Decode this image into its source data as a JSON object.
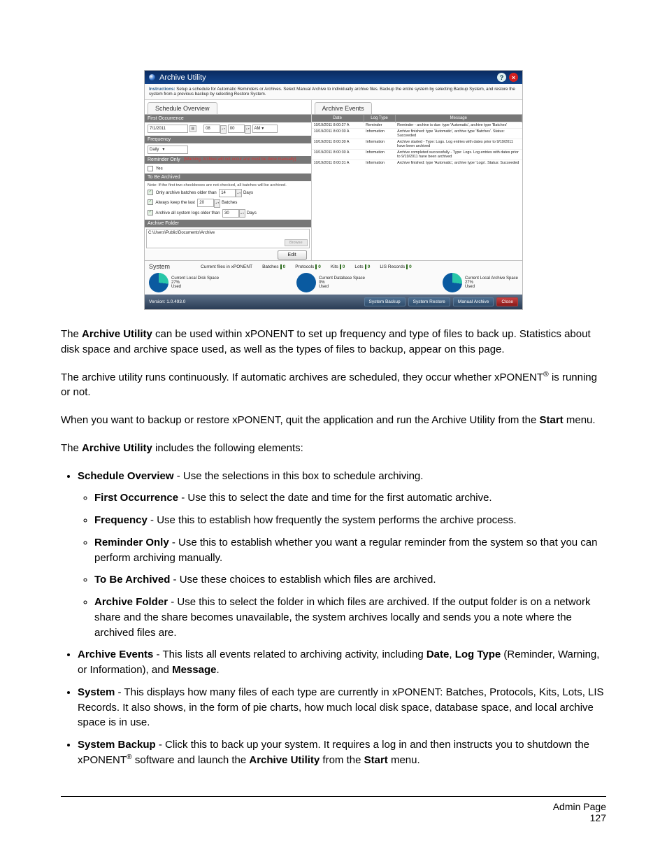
{
  "screenshot": {
    "title": "Archive Utility",
    "instructions_label": "Instructions:",
    "instructions_text": "Setup a schedule for Automatic Reminders or Archives. Select Manual Archive to individually archive files. Backup the entire system by selecting Backup System, and restore the system from a previous backup by selecting Restore System.",
    "tabs": {
      "schedule_overview": "Schedule Overview",
      "archive_events": "Archive Events"
    },
    "schedule": {
      "first_occurrence": {
        "label": "First Occurrence",
        "date": "7/1/2011",
        "hour": "08",
        "minute": "00",
        "ampm": "AM"
      },
      "frequency": {
        "label": "Frequency",
        "value": "Daily"
      },
      "reminder_only": {
        "label": "Reminder Only",
        "warning": "(Warning: Archive will not occur and must be done manually)",
        "checkbox_label": "Yes",
        "checked": false
      },
      "to_be_archived": {
        "label": "To Be Archived",
        "note": "Note: If the first two checkboxes are not checked, all batches will be archived.",
        "only_batches": {
          "label": "Only archive batches older than",
          "value": "14",
          "unit": "Days",
          "checked": true
        },
        "keep_last": {
          "label": "Always keep the last",
          "value": "20",
          "unit": "Batches",
          "checked": true
        },
        "system_logs": {
          "label": "Archive all system logs older than",
          "value": "30",
          "unit": "Days",
          "checked": true
        }
      },
      "archive_folder": {
        "label": "Archive Folder",
        "path": "C:\\Users\\Public\\Documents\\Archive",
        "browse": "Browse"
      },
      "edit_button": "Edit"
    },
    "events": {
      "columns": {
        "date": "Date",
        "log_type": "Log Type",
        "message": "Message"
      },
      "rows": [
        {
          "date": "10/19/2011 8:00:27 A",
          "type": "Reminder",
          "msg": "Reminder - archive is due: type 'Automatic', archive type 'Batches'"
        },
        {
          "date": "10/19/2011 8:00:30 A",
          "type": "Information",
          "msg": "Archive finished: type 'Automatic', archive type 'Batches'. Status: Succeeded"
        },
        {
          "date": "10/19/2011 8:00:30 A",
          "type": "Information",
          "msg": "Archive started - Type: Logs. Log entries with dates prior to 9/19/2011 have been archived"
        },
        {
          "date": "10/19/2011 8:00:30 A",
          "type": "Information",
          "msg": "Archive completed successfully - Type: Logs. Log entries with dates prior to 9/19/2011 have been archived"
        },
        {
          "date": "10/19/2011 8:00:31 A",
          "type": "Information",
          "msg": "Archive finished: type 'Automatic', archive type 'Logs'. Status: Succeeded"
        }
      ]
    },
    "system": {
      "label": "System",
      "files_label": "Current files in xPONENT",
      "batches": {
        "label": "Batches",
        "value": "0"
      },
      "protocols": {
        "label": "Protocols",
        "value": "0"
      },
      "kits": {
        "label": "Kits",
        "value": "0"
      },
      "lots": {
        "label": "Lots",
        "value": "0"
      },
      "lis": {
        "label": "LIS Records",
        "value": "0"
      },
      "disk": {
        "label": "Current Local Disk Space",
        "percent": "27%",
        "used": "Used"
      },
      "db": {
        "label": "Current Database Space",
        "percent": "0%",
        "used": "Used"
      },
      "arch": {
        "label": "Current Local Archive Space",
        "percent": "27%",
        "used": "Used"
      }
    },
    "footer": {
      "version": "Version: 1.0.493.0",
      "buttons": {
        "backup": "System Backup",
        "restore": "System Restore",
        "manual": "Manual Archive",
        "close": "Close"
      }
    }
  },
  "body": {
    "p1_a": "The ",
    "p1_b": "Archive Utility",
    "p1_c": " can be used within xPONENT to set up frequency and type of files to back up. Statistics about disk space and archive space used, as well as the types of files to backup, appear on this page.",
    "p2_a": "The archive utility runs continuously. If automatic archives are scheduled, they occur whether xPONENT",
    "p2_b": " is running or not.",
    "p3": "When you want to backup or restore xPONENT, quit the application and run the Archive Utility from the ",
    "p3_b": "Start",
    "p3_c": " menu.",
    "p4_a": "The ",
    "p4_b": "Archive Utility",
    "p4_c": " includes the following elements:",
    "b1": {
      "t": "Schedule Overview",
      "d": " - Use the selections in this box to schedule archiving."
    },
    "b1a": {
      "t": "First Occurrence",
      "d": " - Use this to select the date and time for the first automatic archive."
    },
    "b1b": {
      "t": "Frequency",
      "d": " - Use this to establish how frequently the system performs the archive process."
    },
    "b1c": {
      "t": "Reminder Only",
      "d": " - Use this to establish whether you want a regular reminder from the system so that you can perform archiving manually."
    },
    "b1d": {
      "t": "To Be Archived",
      "d": " - Use these choices to establish which files are archived."
    },
    "b1e": {
      "t": "Archive Folder",
      "d": " - Use this to select the folder in which files are archived. If the output folder is on a network share and the share becomes unavailable, the system archives locally and sends you a note where the archived files are."
    },
    "b2_a": "Archive Events",
    "b2_b": " - This lists all events related to archiving activity, including ",
    "b2_c": "Date",
    "b2_d": ", ",
    "b2_e": "Log Type",
    "b2_f": " (Reminder, Warning, or Information), and ",
    "b2_g": "Message",
    "b2_h": ".",
    "b3": {
      "t": "System",
      "d": " - This displays how many files of each type are currently in xPONENT: Batches, Protocols, Kits, Lots, LIS Records. It also shows, in the form of pie charts, how much local disk space, database space, and local archive space is in use."
    },
    "b4_a": "System Backup",
    "b4_b": " - Click this to back up your system. It requires a log in and then instructs you to shutdown the xPONENT",
    "b4_c": " software and launch the ",
    "b4_d": "Archive Utility",
    "b4_e": " from the ",
    "b4_f": "Start",
    "b4_g": " menu."
  },
  "footer": {
    "label": "Admin Page",
    "page": "127"
  }
}
